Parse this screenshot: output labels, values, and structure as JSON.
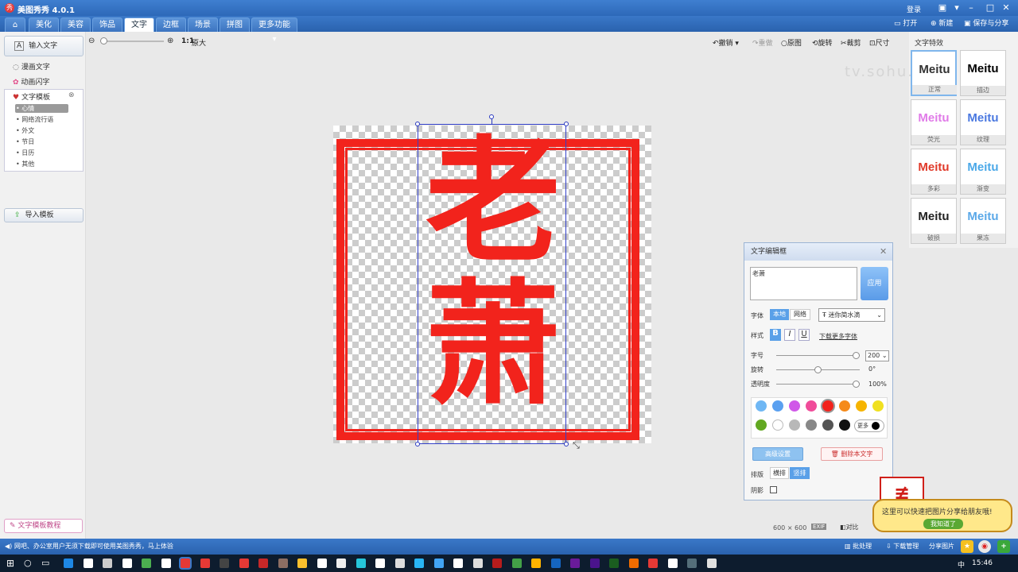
{
  "title_bar": {
    "app_name": "美图秀秀 4.0.1",
    "login": "登录"
  },
  "menu": {
    "tabs": [
      "美化",
      "美容",
      "饰品",
      "文字",
      "边框",
      "场景",
      "拼图",
      "更多功能"
    ],
    "open": "打开",
    "new": "新建",
    "save_share": "保存与分享"
  },
  "left_panel": {
    "input_text": "输入文字",
    "comic_text": "漫画文字",
    "animated_text": "动画闪字",
    "templates": "文字模板",
    "template_items": [
      "心情",
      "网络流行语",
      "外文",
      "节日",
      "日历",
      "其他"
    ],
    "import_template": "导入模板",
    "tutorial": "文字模板教程"
  },
  "toolbar": {
    "ratio": "1:1",
    "original_size": "原大",
    "undo": "撤销",
    "redo": "重做",
    "original": "原图",
    "rotate": "旋转",
    "crop": "裁剪",
    "size": "尺寸"
  },
  "canvas": {
    "char1": "老",
    "char2": "萧"
  },
  "style_panel": {
    "title": "文字特效",
    "styles": [
      {
        "word": "Meitu",
        "label": "正常"
      },
      {
        "word": "Meitu",
        "label": "描边"
      },
      {
        "word": "Meitu",
        "label": "荧光"
      },
      {
        "word": "Meitu",
        "label": "纹理"
      },
      {
        "word": "Meitu",
        "label": "多彩"
      },
      {
        "word": "Meitu",
        "label": "渐变"
      },
      {
        "word": "Meitu",
        "label": "破损"
      },
      {
        "word": "Meitu",
        "label": "果冻"
      }
    ]
  },
  "editor": {
    "title": "文字编辑框",
    "text_value": "老萧",
    "apply": "应用",
    "font_label": "字体",
    "local": "本地",
    "network": "网络",
    "font_name": "迷你简水滴",
    "style_label": "样式",
    "bold": "B",
    "italic": "I",
    "underline": "U",
    "download_fonts": "下载更多字体",
    "size_label": "字号",
    "size_value": "200",
    "rotate_label": "旋转",
    "rotate_value": "0°",
    "opacity_label": "透明度",
    "opacity_value": "100%",
    "more": "更多",
    "advanced": "高级设置",
    "delete": "删除本文字",
    "arrange_label": "排版",
    "horizontal": "横排",
    "vertical": "竖排",
    "shadow_label": "阴影",
    "swatches": [
      "#6fb7f4",
      "#5aa0f0",
      "#d058e8",
      "#f04c9a",
      "#f2231c",
      "#f58a1a",
      "#f6b400",
      "#f0e020",
      "#62a821",
      "#ffffff",
      "#b8b8b8",
      "#888888",
      "#555555",
      "#111111"
    ]
  },
  "bottom": {
    "dims": "600 × 600",
    "exif": "EXIF",
    "compare": "对比",
    "status_text": "网吧、办公室用户无须下载即可使用美图秀秀，马上体验",
    "batch": "批处理",
    "download_mgr": "下载管理",
    "share_pic": "分享图片"
  },
  "toast": {
    "text": "这里可以快速把图片分享给朋友哦!",
    "ok": "我知道了"
  },
  "taskbar": {
    "time": "15:46",
    "ime": "中"
  },
  "watermark": "tv.sohu.com"
}
